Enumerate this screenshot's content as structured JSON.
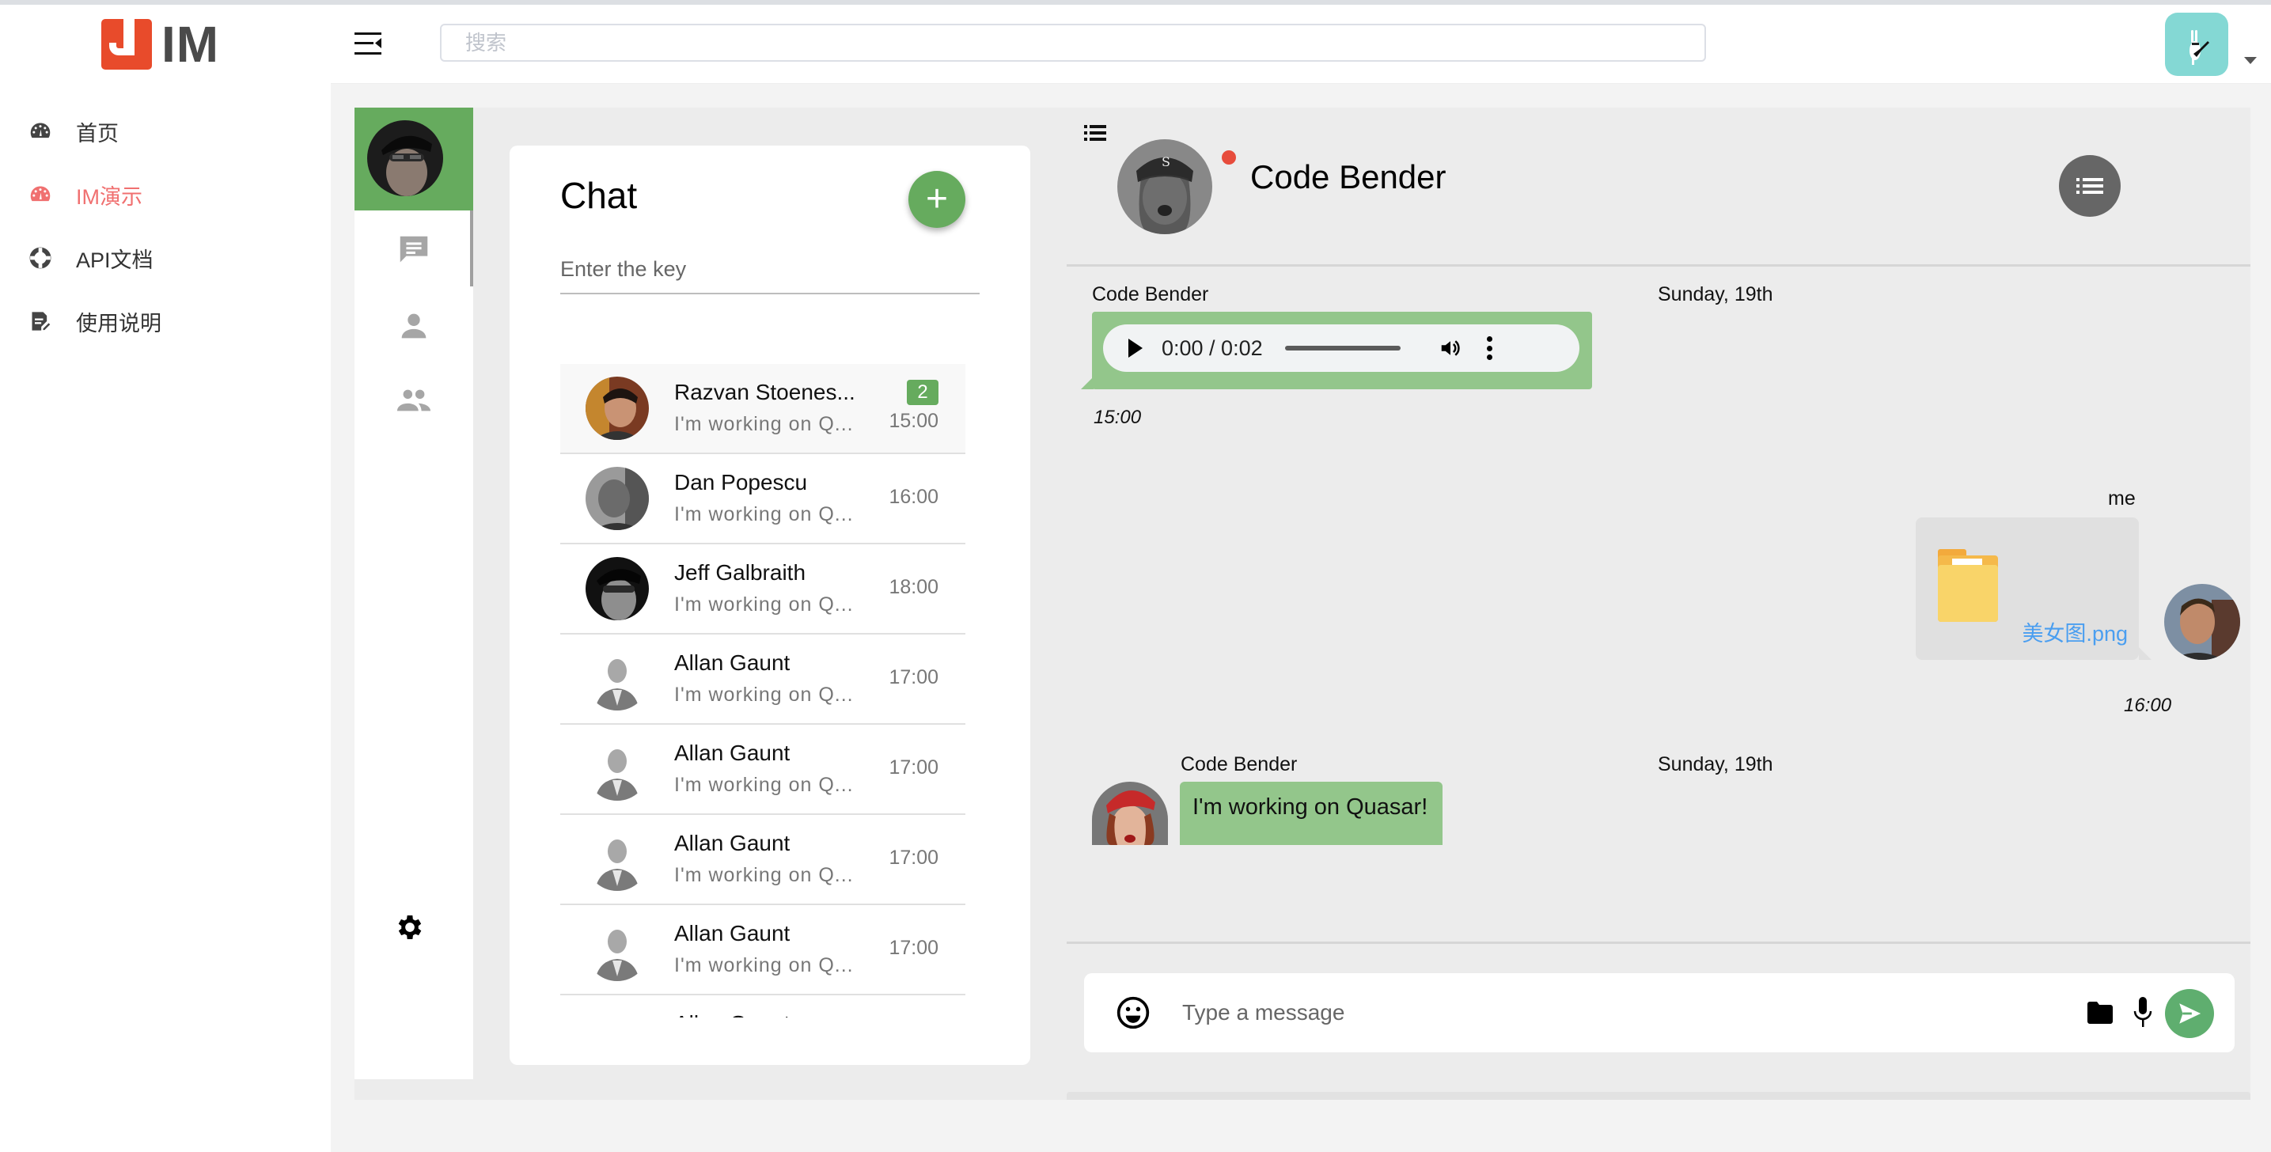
{
  "app": {
    "logo_text": "IM",
    "brand_color": "#e84b2b",
    "accent_green": "#66ab5e",
    "active_nav_color": "#f07070"
  },
  "sidebar": {
    "items": [
      {
        "label": "首页",
        "icon": "dashboard-icon",
        "active": false
      },
      {
        "label": "IM演示",
        "icon": "dashboard-icon",
        "active": true
      },
      {
        "label": "API文档",
        "icon": "lifebuoy-icon",
        "active": false
      },
      {
        "label": "使用说明",
        "icon": "edit-document-icon",
        "active": false
      }
    ]
  },
  "header": {
    "search_placeholder": "搜索",
    "menu_toggle_icon": "menu-collapse-icon",
    "user_avatar_icon": "rabbit-guitar-avatar",
    "caret_icon": "caret-down-icon"
  },
  "rail": {
    "items": [
      {
        "icon": "chat-icon",
        "active": true
      },
      {
        "icon": "person-icon",
        "active": false
      },
      {
        "icon": "group-icon",
        "active": false
      }
    ],
    "settings_icon": "gear-icon"
  },
  "chat_list": {
    "title": "Chat",
    "add_button": "+",
    "search_placeholder": "Enter the key",
    "conversations": [
      {
        "name": "Razvan Stoenes...",
        "preview": "I'm working on Q...",
        "time": "15:00",
        "badge": "2",
        "selected": true
      },
      {
        "name": "Dan Popescu",
        "preview": "I'm working on Q...",
        "time": "16:00",
        "badge": null,
        "selected": false
      },
      {
        "name": "Jeff Galbraith",
        "preview": "I'm working on Q...",
        "time": "18:00",
        "badge": null,
        "selected": false
      },
      {
        "name": "Allan Gaunt",
        "preview": "I'm working on Q...",
        "time": "17:00",
        "badge": null,
        "selected": false
      },
      {
        "name": "Allan Gaunt",
        "preview": "I'm working on Q...",
        "time": "17:00",
        "badge": null,
        "selected": false
      },
      {
        "name": "Allan Gaunt",
        "preview": "I'm working on Q...",
        "time": "17:00",
        "badge": null,
        "selected": false
      },
      {
        "name": "Allan Gaunt",
        "preview": "I'm working on Q...",
        "time": "17:00",
        "badge": null,
        "selected": false
      },
      {
        "name": "Allan Gaunt",
        "preview": "",
        "time": "",
        "badge": null,
        "selected": false
      }
    ]
  },
  "chat_panel": {
    "peer_name": "Code Bender",
    "peer_status": "online",
    "messages": [
      {
        "sender": "Code Bender",
        "date": "Sunday, 19th",
        "type": "audio",
        "audio_time": "0:00 / 0:02",
        "stamp": "15:00"
      },
      {
        "sender": "me",
        "type": "file",
        "file_name": "美女图.png",
        "stamp": "16:00"
      },
      {
        "sender": "Code Bender",
        "date": "Sunday, 19th",
        "type": "text",
        "text": "I'm working on Quasar!"
      }
    ],
    "composer_placeholder": "Type a message"
  }
}
